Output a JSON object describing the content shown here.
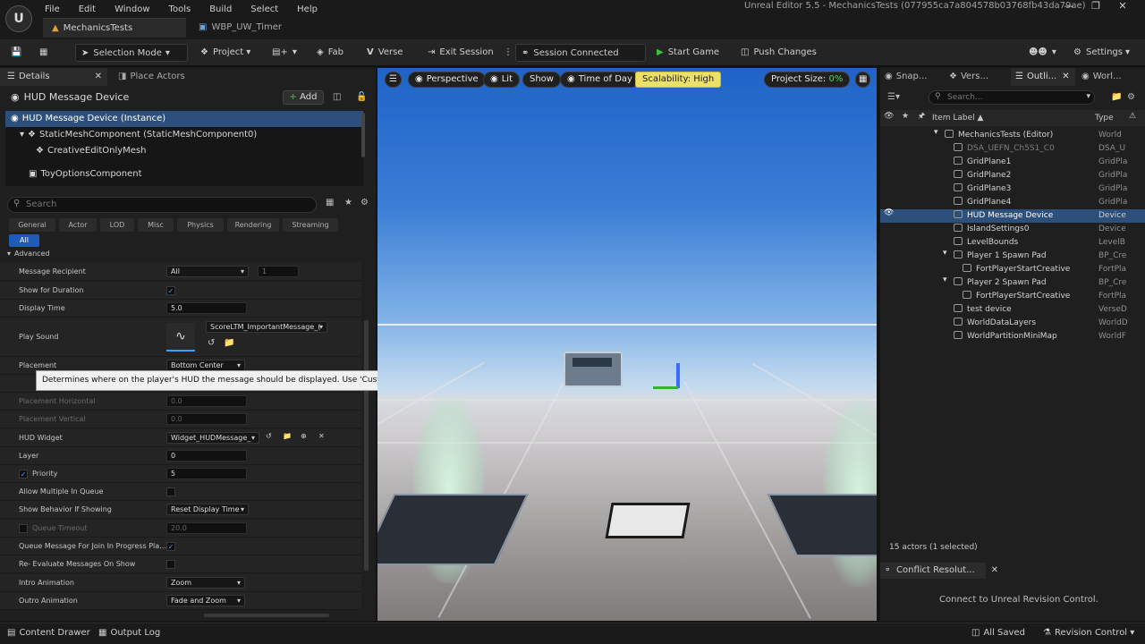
{
  "title_bar": {
    "menus": [
      "File",
      "Edit",
      "Window",
      "Tools",
      "Build",
      "Select",
      "Help"
    ],
    "window_title": "Unreal Editor 5.5 - MechanicsTests (077955ca7a804578b03768fb43da79ae)",
    "tabs": [
      "MechanicsTests",
      "WBP_UW_Timer"
    ]
  },
  "toolbar": {
    "selection_mode": "Selection Mode",
    "project": "Project",
    "fab": "Fab",
    "verse": "Verse",
    "exit_session": "Exit Session",
    "session_connected": "Session Connected",
    "start_game": "Start Game",
    "push_changes": "Push Changes",
    "settings": "Settings"
  },
  "details_panel": {
    "tab_details": "Details",
    "tab_place_actors": "Place Actors",
    "header": "HUD Message Device",
    "add_label": "Add",
    "components": [
      "HUD Message Device (Instance)",
      "StaticMeshComponent (StaticMeshComponent0)",
      "CreativeEditOnlyMesh",
      "ToyOptionsComponent"
    ],
    "search_placeholder": "Search",
    "filter_tabs": [
      "General",
      "Actor",
      "LOD",
      "Misc",
      "Physics",
      "Rendering",
      "Streaming"
    ],
    "filter_all": "All",
    "section": "Advanced",
    "properties": {
      "message_recipient": {
        "label": "Message Recipient",
        "value": "All",
        "extra": "1"
      },
      "show_for_duration": {
        "label": "Show for Duration",
        "checked": true
      },
      "display_time": {
        "label": "Display Time",
        "value": "5.0"
      },
      "play_sound": {
        "label": "Play Sound",
        "value": "ScoreLTM_ImportantMessage_("
      },
      "placement": {
        "label": "Placement",
        "value": "Bottom Center"
      },
      "placement_horizontal": {
        "label": "Placement Horizontal",
        "value": "0.0"
      },
      "placement_vertical": {
        "label": "Placement Vertical",
        "value": "0.0"
      },
      "hud_widget": {
        "label": "HUD Widget",
        "value": "Widget_HUDMessage_"
      },
      "layer": {
        "label": "Layer",
        "value": "0"
      },
      "priority": {
        "label": "Priority",
        "value": "5"
      },
      "allow_multiple": {
        "label": "Allow Multiple In Queue"
      },
      "show_behavior": {
        "label": "Show Behavior If Showing",
        "value": "Reset Display Time"
      },
      "queue_timeout": {
        "label": "Queue Timeout",
        "value": "20.0"
      },
      "queue_join": {
        "label": "Queue Message For Join In Progress Pla...",
        "checked": true
      },
      "reevaluate": {
        "label": "Re- Evaluate Messages On Show"
      },
      "intro_animation": {
        "label": "Intro Animation",
        "value": "Zoom"
      },
      "outro_animation": {
        "label": "Outro Animation",
        "value": "Fade and Zoom"
      }
    },
    "tooltip": "Determines where on the player's HUD the message should be displayed. Use 'Custom' to show fine controls."
  },
  "viewport": {
    "perspective": "Perspective",
    "lit": "Lit",
    "show": "Show",
    "time_of_day": "Time of Day",
    "scalability": "Scalability: High",
    "project_size_label": "Project Size:",
    "project_size_value": "0%"
  },
  "outliner": {
    "tabs": [
      "Snap...",
      "Vers...",
      "Outli...",
      "Worl..."
    ],
    "search_placeholder": "Search...",
    "col_label": "Item Label",
    "col_type": "Type",
    "rows": [
      {
        "label": "MechanicsTests (Editor)",
        "type": "World"
      },
      {
        "label": "DSA_UEFN_Ch5S1_C0",
        "type": "DSA_U"
      },
      {
        "label": "GridPlane1",
        "type": "GridPla"
      },
      {
        "label": "GridPlane2",
        "type": "GridPla"
      },
      {
        "label": "GridPlane3",
        "type": "GridPla"
      },
      {
        "label": "GridPlane4",
        "type": "GridPla"
      },
      {
        "label": "HUD Message Device",
        "type": "Device"
      },
      {
        "label": "IslandSettings0",
        "type": "Device"
      },
      {
        "label": "LevelBounds",
        "type": "LevelB"
      },
      {
        "label": "Player 1 Spawn Pad",
        "type": "BP_Cre"
      },
      {
        "label": "FortPlayerStartCreative",
        "type": "FortPla"
      },
      {
        "label": "Player 2 Spawn Pad",
        "type": "BP_Cre"
      },
      {
        "label": "FortPlayerStartCreative",
        "type": "FortPla"
      },
      {
        "label": "test device",
        "type": "VerseD"
      },
      {
        "label": "WorldDataLayers",
        "type": "WorldD"
      },
      {
        "label": "WorldPartitionMiniMap",
        "type": "WorldF"
      }
    ],
    "actors_count": "15 actors (1 selected)",
    "conflict_tab": "Conflict Resolut...",
    "connect_msg": "Connect to Unreal Revision Control."
  },
  "status_bar": {
    "content_drawer": "Content Drawer",
    "output_log": "Output Log",
    "all_saved": "All Saved",
    "revision_control": "Revision Control"
  }
}
